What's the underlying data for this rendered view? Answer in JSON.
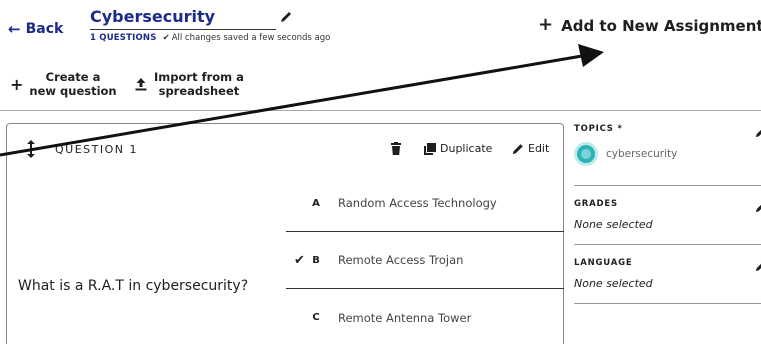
{
  "header": {
    "back_label": "Back",
    "title": "Cybersecurity",
    "question_count": "1 QUESTIONS",
    "saved_status": "All changes saved a few seconds ago",
    "add_assignment_label": "Add to New Assignment"
  },
  "toolbar": {
    "create_line1": "Create a",
    "create_line2": "new question",
    "import_line1": "Import from a",
    "import_line2": "spreadsheet"
  },
  "question": {
    "number_label": "QUESTION 1",
    "duplicate_label": "Duplicate",
    "edit_label": "Edit",
    "text": "What is a R.A.T in cybersecurity?",
    "answers": [
      {
        "letter": "A",
        "text": "Random Access Technology",
        "correct": false
      },
      {
        "letter": "B",
        "text": "Remote Access Trojan",
        "correct": true
      },
      {
        "letter": "C",
        "text": "Remote Antenna Tower",
        "correct": false
      }
    ]
  },
  "sidebar": {
    "topics_label": "TOPICS *",
    "topic_name": "cybersecurity",
    "grades_label": "GRADES",
    "grades_value": "None selected",
    "language_label": "LANGUAGE",
    "language_value": "None selected"
  },
  "colors": {
    "brand": "#1c2a8a",
    "topic_teal": "#2bb3b8"
  }
}
